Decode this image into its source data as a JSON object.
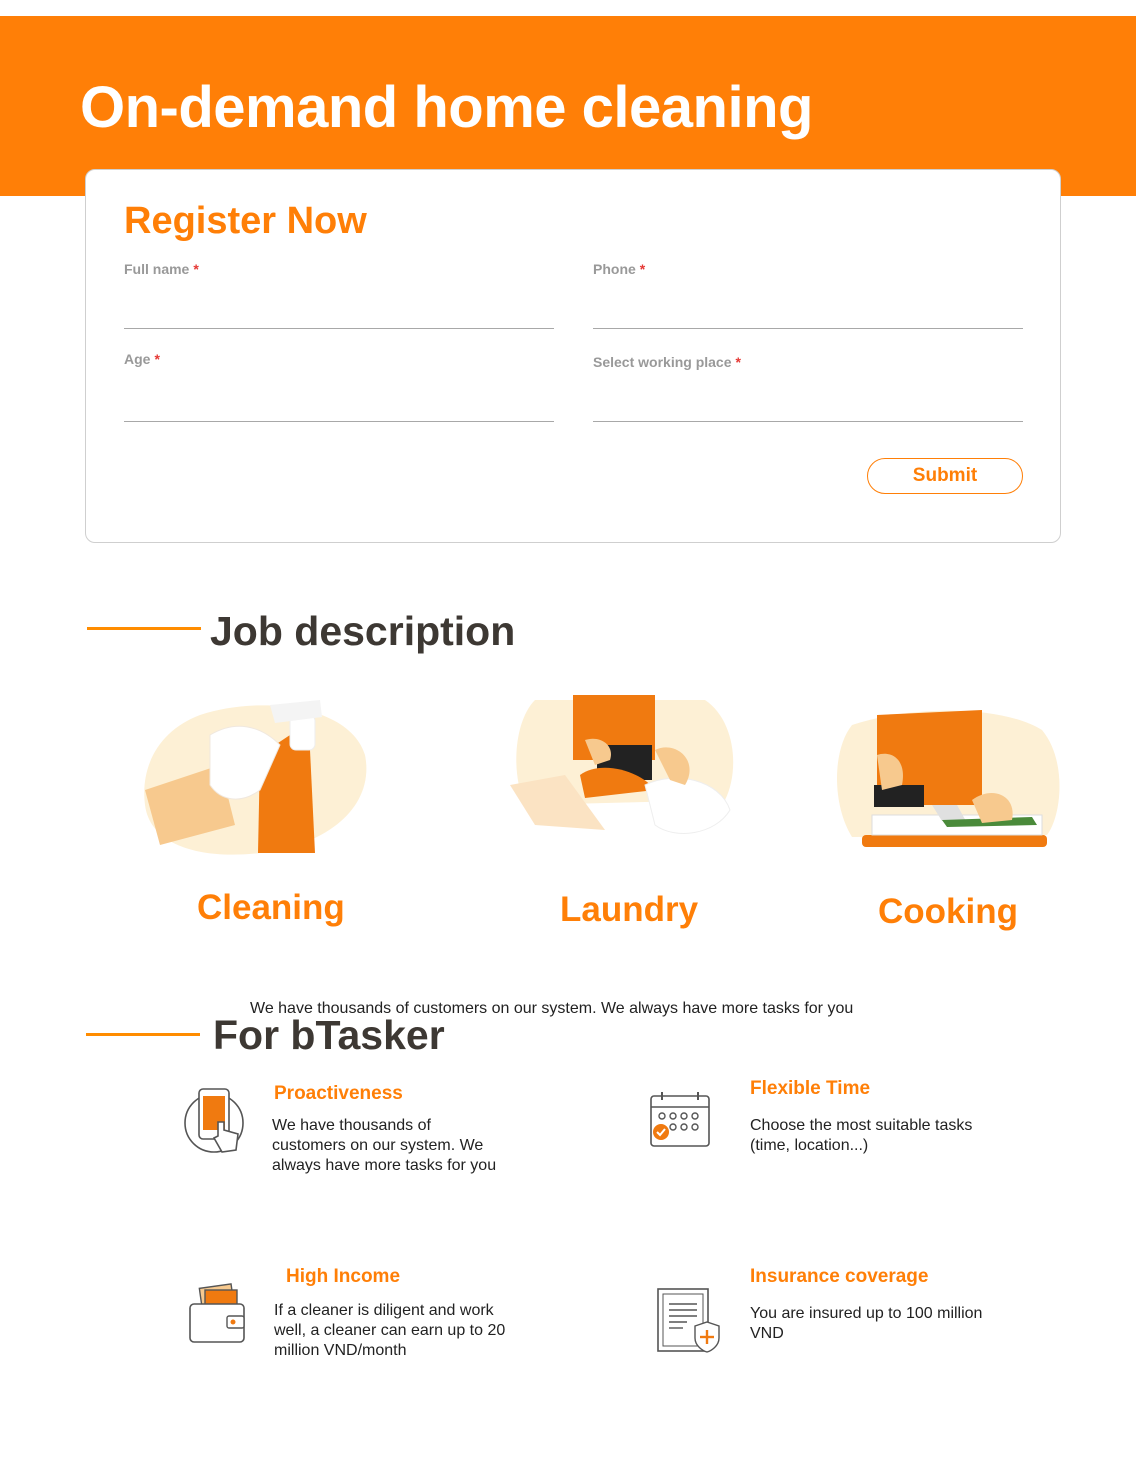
{
  "hero": {
    "title": "On-demand home cleaning"
  },
  "form": {
    "title": "Register Now",
    "required_mark": "*",
    "fields": {
      "full_name": {
        "label": "Full name",
        "value": ""
      },
      "phone": {
        "label": "Phone",
        "value": ""
      },
      "age": {
        "label": "Age",
        "value": ""
      },
      "working_place": {
        "label": "Select working place",
        "value": ""
      }
    },
    "submit_label": "Submit"
  },
  "job_description": {
    "title": "Job description",
    "items": [
      {
        "label": "Cleaning",
        "icon": "spray-bottle-illustration"
      },
      {
        "label": "Laundry",
        "icon": "ironing-illustration"
      },
      {
        "label": "Cooking",
        "icon": "chopping-illustration"
      }
    ]
  },
  "for_btasker": {
    "tagline": "We have thousands of customers on our system. We always have more tasks for you",
    "title": "For bTasker",
    "features": [
      {
        "title": "Proactiveness",
        "desc": "We have thousands of customers on our system. We always have more tasks for you",
        "icon": "phone-tap-icon"
      },
      {
        "title": "Flexible Time",
        "desc": "Choose the most suitable tasks (time, location...)",
        "icon": "calendar-icon"
      },
      {
        "title": "High Income",
        "desc": "If a cleaner is diligent and work well, a cleaner can earn up to 20 million VND/month",
        "icon": "wallet-icon"
      },
      {
        "title": "Insurance coverage",
        "desc": "You are insured up to 100 million VND",
        "icon": "insurance-document-icon"
      }
    ]
  },
  "colors": {
    "accent": "#ff7f07",
    "heading": "#3d3833",
    "required": "#e53935"
  }
}
